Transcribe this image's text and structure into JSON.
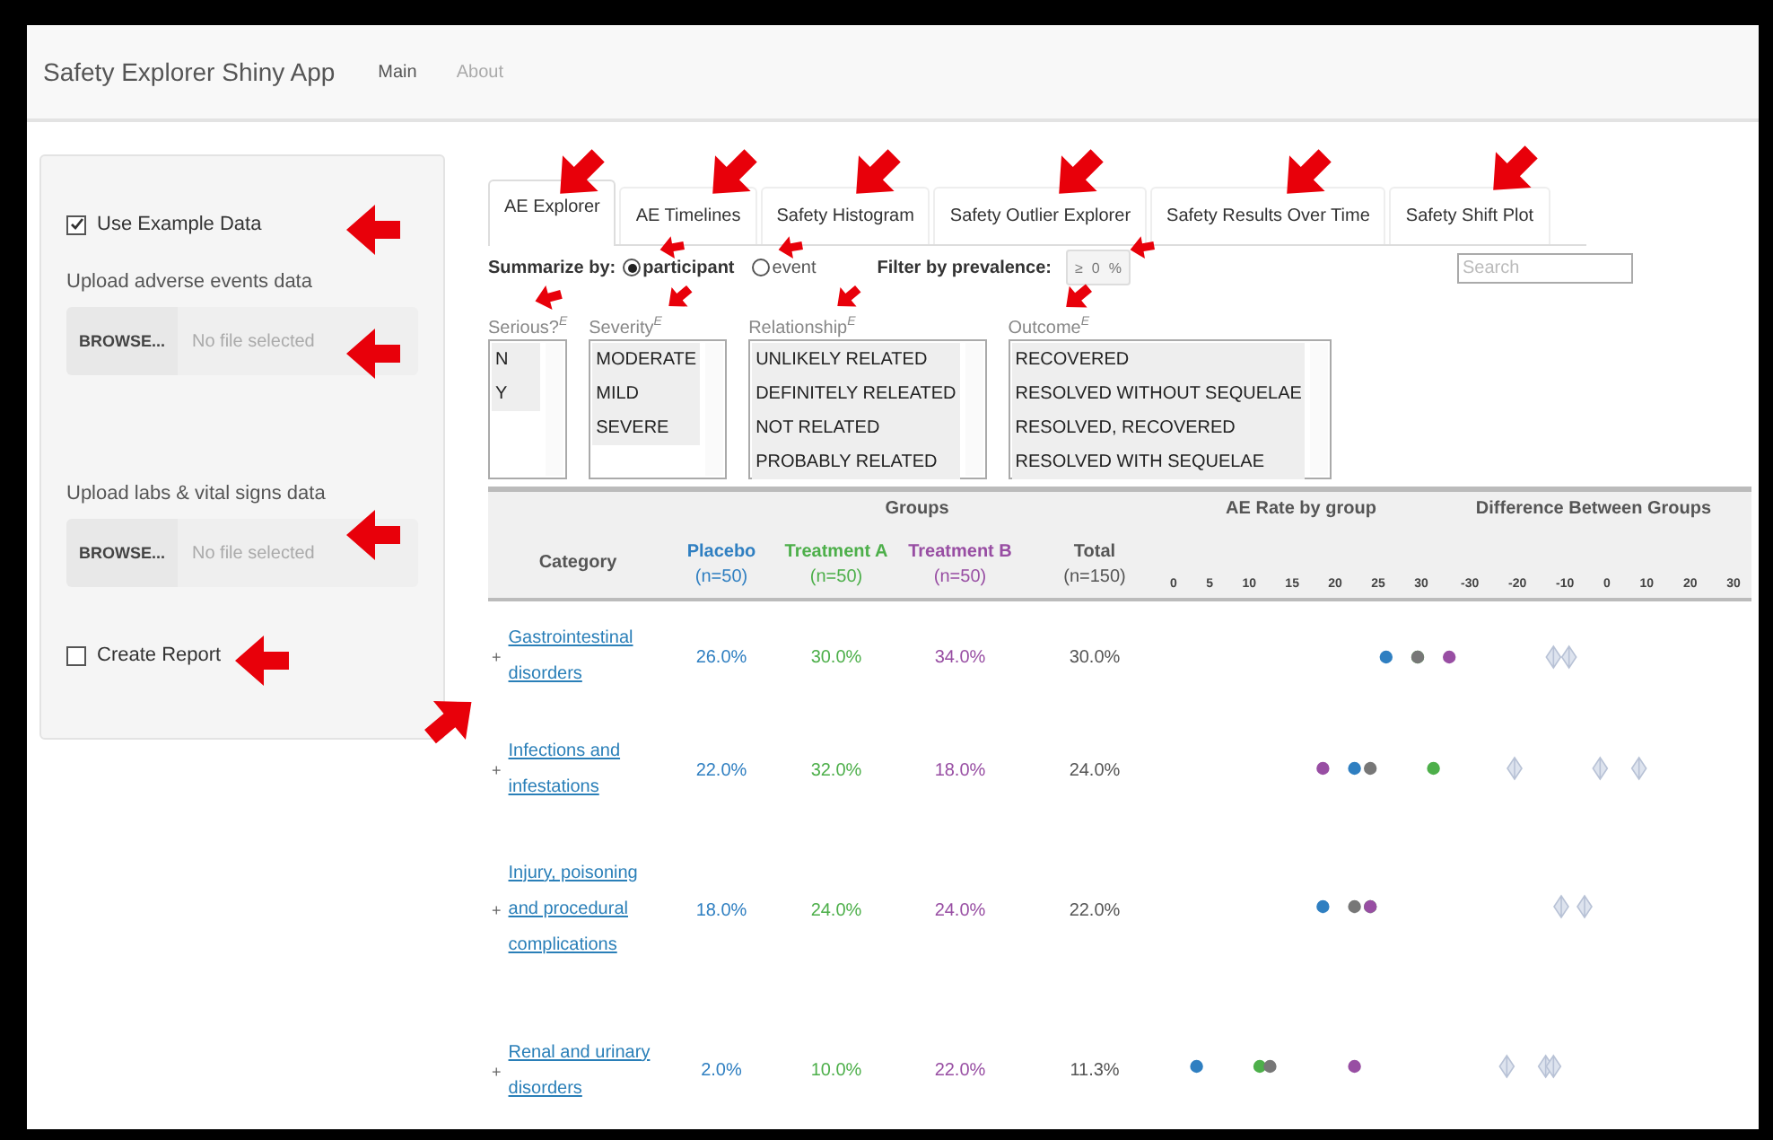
{
  "navbar": {
    "title": "Safety Explorer Shiny App",
    "links": [
      {
        "label": "Main",
        "selected": true
      },
      {
        "label": "About",
        "selected": false
      }
    ]
  },
  "sidebar": {
    "example_data": {
      "label": "Use Example Data",
      "checked": true
    },
    "uploads": [
      {
        "label": "Upload adverse events data",
        "button": "BROWSE...",
        "placeholder": "No file selected"
      },
      {
        "label": "Upload labs & vital signs data",
        "button": "BROWSE...",
        "placeholder": "No file selected"
      }
    ],
    "create_report": {
      "label": "Create Report",
      "checked": false
    }
  },
  "tabs": [
    {
      "label": "AE Explorer",
      "selected": true
    },
    {
      "label": "AE Timelines",
      "selected": false
    },
    {
      "label": "Safety Histogram",
      "selected": false
    },
    {
      "label": "Safety Outlier Explorer",
      "selected": false
    },
    {
      "label": "Safety Results Over Time",
      "selected": false
    },
    {
      "label": "Safety Shift Plot",
      "selected": false
    }
  ],
  "controls": {
    "summarize_label": "Summarize by:",
    "options": [
      {
        "label": "participant",
        "selected": true
      },
      {
        "label": "event",
        "selected": false
      }
    ],
    "filter_label": "Filter by prevalence:",
    "filter_prefix": "≥",
    "filter_value": "0",
    "filter_suffix": "%",
    "search": {
      "placeholder": "Search"
    }
  },
  "filters": [
    {
      "label": "Serious?",
      "marker": "E",
      "items": [
        {
          "label": "N",
          "selected": true
        },
        {
          "label": "Y",
          "selected": true
        }
      ]
    },
    {
      "label": "Severity",
      "marker": "E",
      "items": [
        {
          "label": "MODERATE",
          "selected": true
        },
        {
          "label": "MILD",
          "selected": true
        },
        {
          "label": "SEVERE",
          "selected": true
        }
      ]
    },
    {
      "label": "Relationship",
      "marker": "E",
      "items": [
        {
          "label": "UNLIKELY RELATED",
          "selected": true
        },
        {
          "label": "DEFINITELY RELEATED",
          "selected": true
        },
        {
          "label": "NOT RELATED",
          "selected": true
        },
        {
          "label": "PROBABLY RELATED",
          "selected": true
        }
      ]
    },
    {
      "label": "Outcome",
      "marker": "E",
      "items": [
        {
          "label": "RECOVERED",
          "selected": true
        },
        {
          "label": "RESOLVED WITHOUT SEQUELAE",
          "selected": true
        },
        {
          "label": "RESOLVED, RECOVERED",
          "selected": true
        },
        {
          "label": "RESOLVED WITH SEQUELAE",
          "selected": true
        }
      ]
    }
  ],
  "table": {
    "groups_heading": "Groups",
    "category_heading": "Category",
    "columns": [
      {
        "name": "Placebo",
        "n": "(n=50)",
        "color": "#2f7fc1"
      },
      {
        "name": "Treatment A",
        "n": "(n=50)",
        "color": "#4daf4a"
      },
      {
        "name": "Treatment B",
        "n": "(n=50)",
        "color": "#984ea3"
      },
      {
        "name": "Total",
        "n": "(n=150)",
        "color": "#555555"
      }
    ],
    "rate_heading": "AE Rate by group",
    "rate_ticks": [
      "0",
      "5",
      "10",
      "15",
      "20",
      "25",
      "30"
    ],
    "diff_heading": "Difference Between Groups",
    "diff_ticks": [
      "-30",
      "-20",
      "-10",
      "0",
      "10",
      "20",
      "30"
    ],
    "rows": [
      {
        "expander": "+",
        "category": "Gastrointestinal disorders",
        "values": [
          "26.0%",
          "30.0%",
          "34.0%",
          "30.0%"
        ]
      },
      {
        "expander": "+",
        "category": "Infections and infestations",
        "values": [
          "22.0%",
          "32.0%",
          "18.0%",
          "24.0%"
        ]
      },
      {
        "expander": "+",
        "category": "Injury, poisoning and procedural complications",
        "values": [
          "18.0%",
          "24.0%",
          "24.0%",
          "22.0%"
        ]
      },
      {
        "expander": "+",
        "category": "Renal and urinary disorders",
        "values": [
          "2.0%",
          "10.0%",
          "22.0%",
          "11.3%"
        ]
      }
    ]
  }
}
